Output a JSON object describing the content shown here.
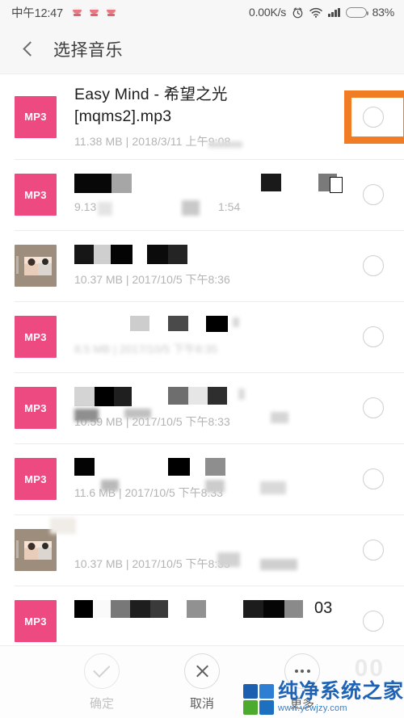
{
  "status_bar": {
    "clock": "中午12:47",
    "net_speed": "0.00K/s",
    "battery_pct": "83%",
    "battery_level": 83,
    "icons": [
      "alarm-icon",
      "wifi-icon",
      "signal-icon",
      "battery-icon"
    ],
    "notification_icons": [
      "app-notif-icon",
      "app-notif-icon",
      "app-notif-icon"
    ]
  },
  "app_bar": {
    "back_icon": "chevron-left-icon",
    "title": "选择音乐"
  },
  "colors": {
    "mp3_icon": "#ec4a80",
    "album_art": "#9d8d7c",
    "highlight_box": "#f07d23",
    "battery": "#f7941e",
    "status_bar_bg": "#f7f7f7",
    "divider": "#ececec",
    "meta_text": "#b4b4b4"
  },
  "list": {
    "rows": [
      {
        "icon": "mp3",
        "icon_label": "MP3",
        "title": "Easy Mind - 希望之光\n[mqms2].mp3",
        "meta": "11.38 MB | 2018/3/11 上午9:08",
        "title_redacted": false,
        "meta_redacted": false,
        "highlighted": true,
        "selected": false
      },
      {
        "icon": "mp3",
        "icon_label": "MP3",
        "title": "",
        "meta": "9.13",
        "meta_tail": "1:54",
        "title_redacted": true,
        "meta_redacted": true,
        "highlighted": false,
        "selected": false
      },
      {
        "icon": "art",
        "icon_label": "",
        "title": "",
        "meta": "10.37 MB | 2017/10/5 下午8:36",
        "title_redacted": true,
        "meta_redacted": false,
        "highlighted": false,
        "selected": false
      },
      {
        "icon": "mp3",
        "icon_label": "MP3",
        "title": "",
        "meta": "8.5 MB | 2017/10/5 下午8:35",
        "title_redacted": true,
        "meta_redacted": true,
        "highlighted": false,
        "selected": false
      },
      {
        "icon": "mp3",
        "icon_label": "MP3",
        "title": "",
        "meta": "10.59 MB | 2017/10/5 下午8:33",
        "title_redacted": true,
        "meta_redacted": true,
        "highlighted": false,
        "selected": false
      },
      {
        "icon": "mp3",
        "icon_label": "MP3",
        "title": "",
        "meta": "11.6 MB | 2017/10/5 下午8:33",
        "title_redacted": true,
        "meta_redacted": true,
        "highlighted": false,
        "selected": false
      },
      {
        "icon": "art",
        "icon_label": "",
        "title": "",
        "meta": "10.37 MB | 2017/10/5 下午8:33",
        "title_redacted": true,
        "meta_redacted": true,
        "highlighted": false,
        "selected": false
      },
      {
        "icon": "mp3",
        "icon_label": "MP3",
        "title": "",
        "meta": "",
        "meta_tail": "03",
        "title_redacted": true,
        "meta_redacted": true,
        "highlighted": false,
        "selected": false
      }
    ]
  },
  "bottom_bar": {
    "buttons": [
      {
        "label": "确定",
        "icon": "check-icon",
        "disabled": true
      },
      {
        "label": "取消",
        "icon": "close-icon",
        "disabled": false
      },
      {
        "label": "更多",
        "icon": "more-dots-icon",
        "disabled": false
      }
    ]
  },
  "watermark": {
    "name": "纯净系统之家",
    "url": "www.ycwjzy.com",
    "ghost_text": "00"
  }
}
